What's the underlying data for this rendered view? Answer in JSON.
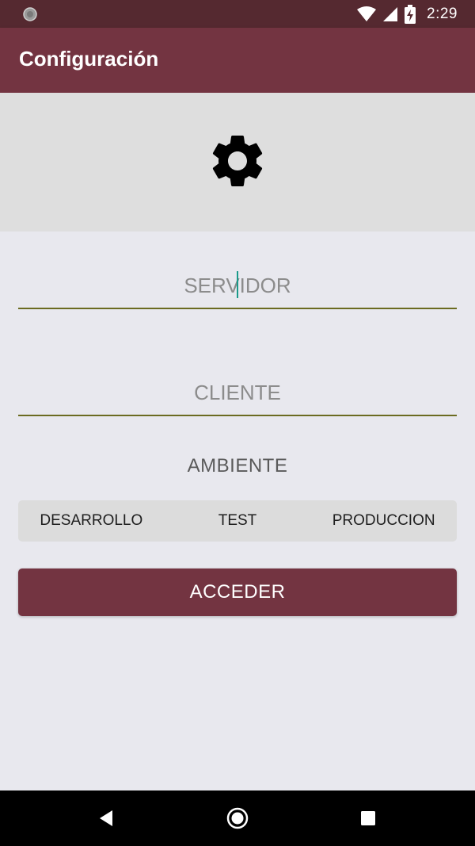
{
  "status_bar": {
    "time": "2:29",
    "left_icon": "circle-icon",
    "icons": [
      "wifi-icon",
      "signal-icon",
      "battery-charging-icon"
    ]
  },
  "app_bar": {
    "title": "Configuración",
    "color": "#733441"
  },
  "header": {
    "icon": "gear-icon"
  },
  "form": {
    "servidor": {
      "placeholder": "SERVIDOR",
      "value": ""
    },
    "cliente": {
      "placeholder": "CLIENTE",
      "value": ""
    },
    "ambiente_label": "AMBIENTE",
    "ambiente_options": [
      "DESARROLLO",
      "TEST",
      "PRODUCCION"
    ],
    "submit_label": "ACCEDER"
  },
  "nav": {
    "icons": [
      "back-icon",
      "home-icon",
      "recents-icon"
    ]
  },
  "colors": {
    "primary": "#733441",
    "primary_dark": "#552930",
    "underline": "#6b6b20",
    "cursor": "#1a9a8a"
  }
}
